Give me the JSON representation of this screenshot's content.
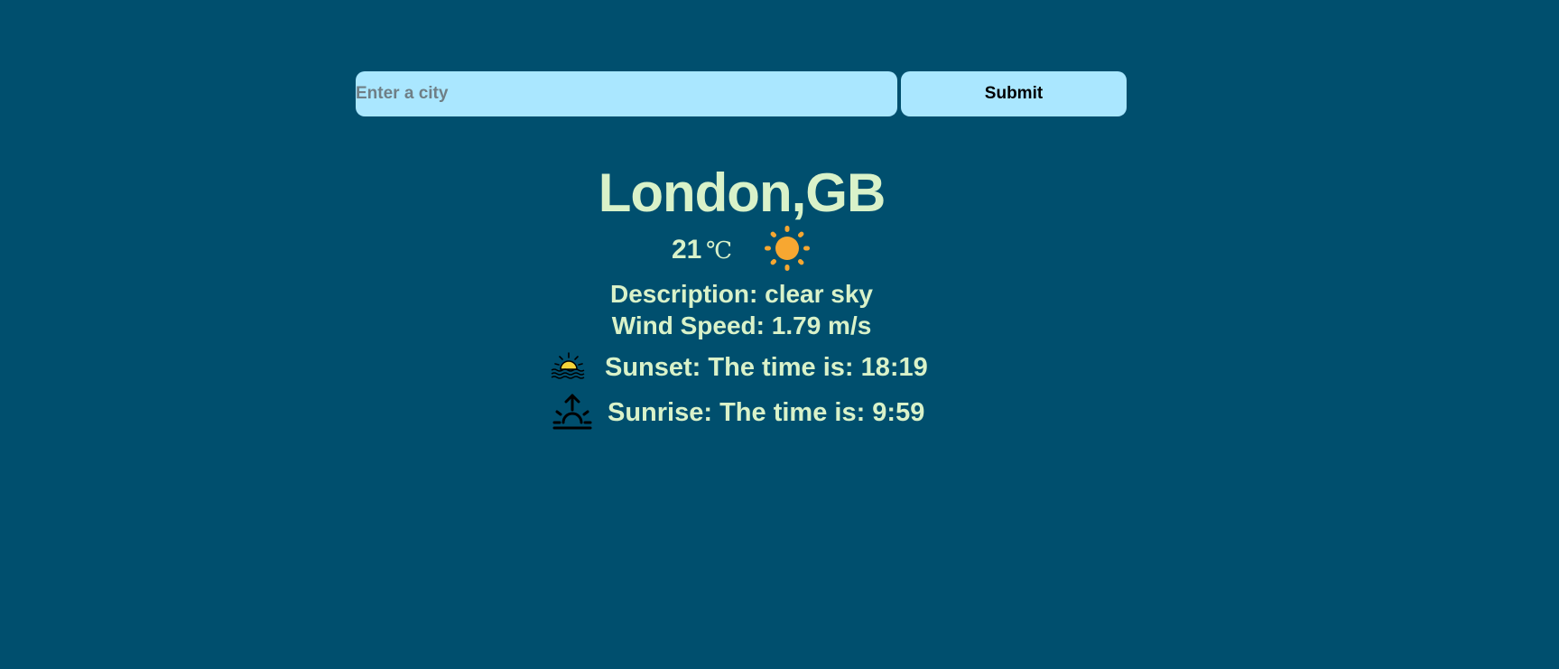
{
  "search": {
    "placeholder": "Enter a city",
    "value": "",
    "submit_label": "Submit"
  },
  "weather": {
    "location": "London,GB",
    "temperature": "21",
    "unit": "℃",
    "condition_icon": "sun-icon",
    "description": "Description: clear sky",
    "wind_speed": "Wind Speed: 1.79 m/s",
    "sunset": "Sunset: The time is: 18:19",
    "sunrise": "Sunrise: The time is: 9:59"
  },
  "colors": {
    "background": "#004f6e",
    "input_bg": "#aae7ff",
    "text": "#d9f2c9",
    "sun": "#f7a731"
  }
}
